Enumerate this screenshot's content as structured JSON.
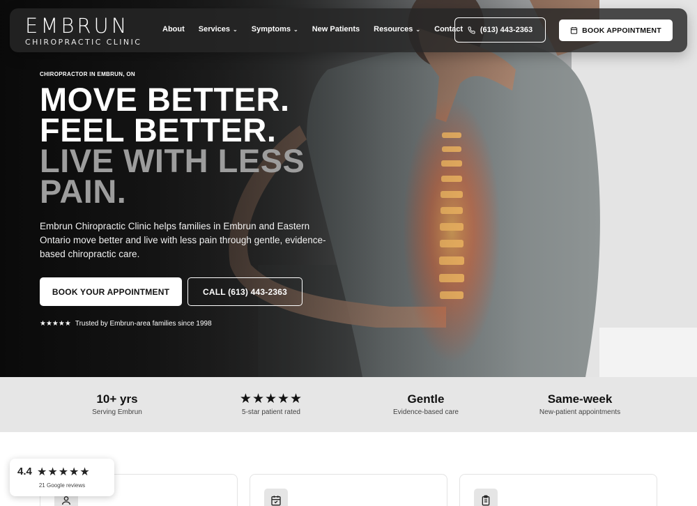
{
  "brand": {
    "name": "EMBRUN",
    "tagline": "CHIROPRACTIC CLINIC"
  },
  "nav": {
    "links": [
      {
        "label": "About",
        "dropdown": false
      },
      {
        "label": "Services",
        "dropdown": true
      },
      {
        "label": "Symptoms",
        "dropdown": true
      },
      {
        "label": "New Patients",
        "dropdown": false
      },
      {
        "label": "Resources",
        "dropdown": true
      },
      {
        "label": "Contact",
        "dropdown": false
      }
    ],
    "phone_label": "(613) 443-2363",
    "book_label": "BOOK APPOINTMENT"
  },
  "hero": {
    "eyebrow": "CHIROPRACTOR IN EMBRUN, ON",
    "headline_line1": "MOVE BETTER.",
    "headline_line2": "FEEL BETTER.",
    "headline_line3": "LIVE WITH LESS",
    "headline_line4": "PAIN.",
    "lede": "Embrun Chiropractic Clinic helps families in Embrun and Eastern Ontario move better and live with less pain through gentle, evidence-based chiropractic care.",
    "cta_primary": "BOOK YOUR APPOINTMENT",
    "cta_secondary": "CALL (613) 443-2363",
    "trust_stars": "★★★★★",
    "trust_text": "Trusted by Embrun-area families since 1998"
  },
  "stats": [
    {
      "value": "10+ yrs",
      "label": "Serving Embrun"
    },
    {
      "value": "★★★★★",
      "label": "5-star patient rated"
    },
    {
      "value": "Gentle",
      "label": "Evidence-based care"
    },
    {
      "value": "Same-week",
      "label": "New-patient appointments"
    }
  ],
  "cards": [
    {
      "icon": "user-icon"
    },
    {
      "icon": "calendar-check-icon"
    },
    {
      "icon": "clipboard-icon"
    }
  ],
  "review_badge": {
    "rating": "4.4",
    "stars": "★★★★★",
    "count_text": "21 Google reviews"
  },
  "colors": {
    "hero_dark": "#111111",
    "accent_spine": "#e85a1e",
    "stats_bg": "#e6e6e6",
    "white": "#ffffff"
  }
}
